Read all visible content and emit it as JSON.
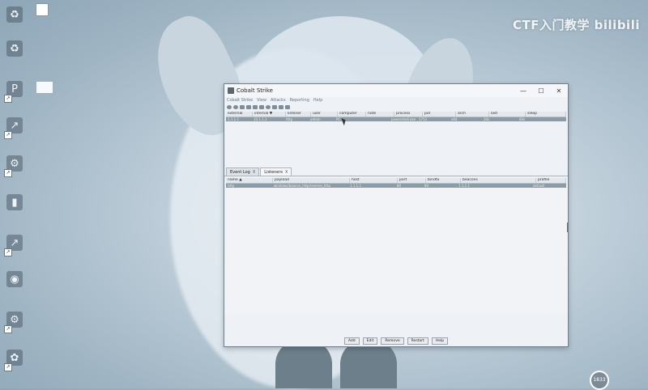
{
  "desktop": {
    "watermark": "CTF入门教学 bilibili",
    "clock_badge": "1833",
    "icons": [
      {
        "name": "recycle-bin-icon",
        "glyph": "♻"
      },
      {
        "name": "p-app-icon",
        "glyph": "P"
      },
      {
        "name": "shortcut-icon",
        "glyph": "↗"
      },
      {
        "name": "tool-icon",
        "glyph": "⚙"
      },
      {
        "name": "document-icon",
        "glyph": "▮"
      },
      {
        "name": "shortcut-icon-2",
        "glyph": "↗"
      },
      {
        "name": "camera-icon",
        "glyph": "◉"
      },
      {
        "name": "gear-app-icon",
        "glyph": "⚙"
      },
      {
        "name": "plant-app-icon",
        "glyph": "✿"
      }
    ]
  },
  "window": {
    "title": "Cobalt Strike",
    "controls": {
      "minimize": "—",
      "maximize": "☐",
      "close": "✕"
    },
    "menu": [
      "Cobalt Strike",
      "View",
      "Attacks",
      "Reporting",
      "Help"
    ],
    "sessions": {
      "columns": [
        "external",
        "internal ▼",
        "listener",
        "user",
        "computer",
        "note",
        "process",
        "pid",
        "arch",
        "last",
        "sleep"
      ],
      "rows": [
        [
          "1.1.1.1",
          "10.1.1.1",
          "http",
          "admin",
          "PC",
          "",
          "powershell.exe",
          "1752",
          "x64",
          "20s",
          "60s"
        ]
      ]
    },
    "tabs": [
      {
        "label": "Event Log",
        "close": "X"
      },
      {
        "label": "Listeners",
        "close": "X"
      }
    ],
    "listeners": {
      "columns": [
        "name ▲",
        "payload",
        "host",
        "port",
        "bindto",
        "beacons",
        "profile"
      ],
      "rows": [
        [
          "http",
          "windows/beacon_http/reverse_http",
          "1.1.1.1",
          "80",
          "80",
          "1.1.1.1",
          "default"
        ]
      ]
    },
    "buttons": [
      "Add",
      "Edit",
      "Remove",
      "Restart",
      "Help"
    ]
  }
}
